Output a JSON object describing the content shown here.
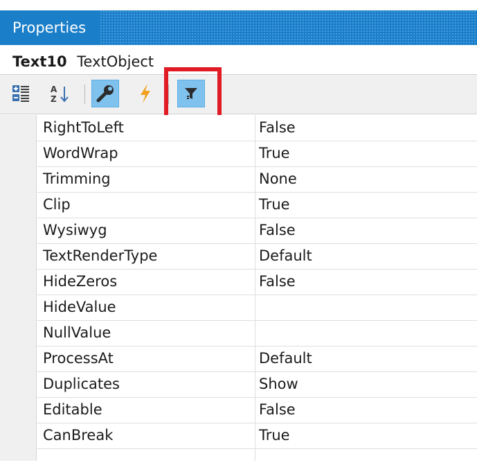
{
  "panel": {
    "title": "Properties"
  },
  "object": {
    "name": "Text10",
    "type": "TextObject"
  },
  "toolbar": {
    "buttons": [
      {
        "icon": "categorized-icon",
        "active": false
      },
      {
        "icon": "sort-alphabetical-icon",
        "active": false
      },
      {
        "icon": "wrench-icon",
        "active": true
      },
      {
        "icon": "lightning-icon",
        "active": false
      },
      {
        "icon": "filter-icon",
        "active": true
      }
    ]
  },
  "properties": [
    {
      "name": "RightToLeft",
      "value": "False"
    },
    {
      "name": "WordWrap",
      "value": "True"
    },
    {
      "name": "Trimming",
      "value": "None"
    },
    {
      "name": "Clip",
      "value": "True"
    },
    {
      "name": "Wysiwyg",
      "value": "False"
    },
    {
      "name": "TextRenderType",
      "value": "Default"
    },
    {
      "name": "HideZeros",
      "value": "False"
    },
    {
      "name": "HideValue",
      "value": ""
    },
    {
      "name": "NullValue",
      "value": ""
    },
    {
      "name": "ProcessAt",
      "value": "Default"
    },
    {
      "name": "Duplicates",
      "value": "Show"
    },
    {
      "name": "Editable",
      "value": "False"
    },
    {
      "name": "CanBreak",
      "value": "True"
    }
  ],
  "colors": {
    "title_bar": "#1b7ec9",
    "active_button": "#7fc2ee",
    "highlight": "#e01b24"
  }
}
